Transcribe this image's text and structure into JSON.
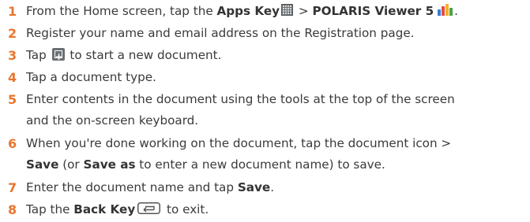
{
  "steps": [
    {
      "num": "1",
      "a": "From the Home screen, tap the ",
      "b": "Apps Key",
      "c": " > ",
      "d": "POLARIS Viewer 5",
      "e": "."
    },
    {
      "num": "2",
      "text": "Register your name and email address on the Registration page."
    },
    {
      "num": "3",
      "a": "Tap ",
      "b": " to start a new document."
    },
    {
      "num": "4",
      "text": "Tap a document type."
    },
    {
      "num": "5",
      "line1": "Enter contents in the document using the tools at the top of the screen",
      "line2": "and the on-screen keyboard."
    },
    {
      "num": "6",
      "line1": "When you're done working on the document, tap the document icon >",
      "b1": "Save",
      "m1": " (or ",
      "b2": "Save as",
      "m2": " to enter a new document name) to save."
    },
    {
      "num": "7",
      "a": "Enter the document name and tap ",
      "b": "Save",
      "c": "."
    },
    {
      "num": "8",
      "a": "Tap the ",
      "b": "Back Key",
      "c": " to exit."
    }
  ],
  "icons": {
    "apps_key": "apps-grid-icon",
    "polaris": "polaris-viewer-icon",
    "new_doc": "new-document-plus-icon",
    "back_key": "back-key-icon"
  },
  "colors": {
    "number": "#e8762d",
    "text": "#3a3a3a"
  }
}
